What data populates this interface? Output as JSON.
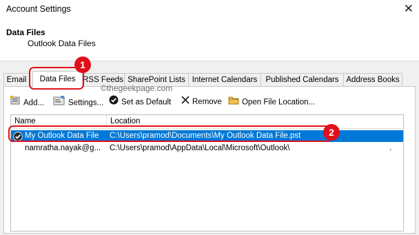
{
  "window": {
    "title": "Account Settings",
    "close_glyph": "✕"
  },
  "header": {
    "title": "Data Files",
    "subtitle": "Outlook Data Files"
  },
  "tabs": [
    {
      "label": "Email"
    },
    {
      "label": "Data Files",
      "active": true
    },
    {
      "label": "RSS Feeds"
    },
    {
      "label": "SharePoint Lists"
    },
    {
      "label": "Internet Calendars"
    },
    {
      "label": "Published Calendars"
    },
    {
      "label": "Address Books"
    }
  ],
  "watermark": "©thegeekpage.com",
  "toolbar": {
    "add": "Add...",
    "settings": "Settings...",
    "set_default": "Set as Default",
    "remove": "Remove",
    "open_location": "Open File Location..."
  },
  "list": {
    "columns": [
      "Name",
      "Location"
    ],
    "rows": [
      {
        "name": "My Outlook Data File",
        "location": "C:\\Users\\pramod\\Documents\\My Outlook Data File.pst",
        "selected": true,
        "is_default": true
      },
      {
        "name": "namratha.nayak@g...",
        "location": "C:\\Users\\pramod\\AppData\\Local\\Microsoft\\Outlook\\",
        "selected": false,
        "trailing": "."
      }
    ]
  },
  "callouts": [
    {
      "number": "1"
    },
    {
      "number": "2"
    }
  ],
  "colors": {
    "selection": "#0078d7",
    "callout": "#e0101a",
    "dialog_bg": "#f0f0f0"
  }
}
